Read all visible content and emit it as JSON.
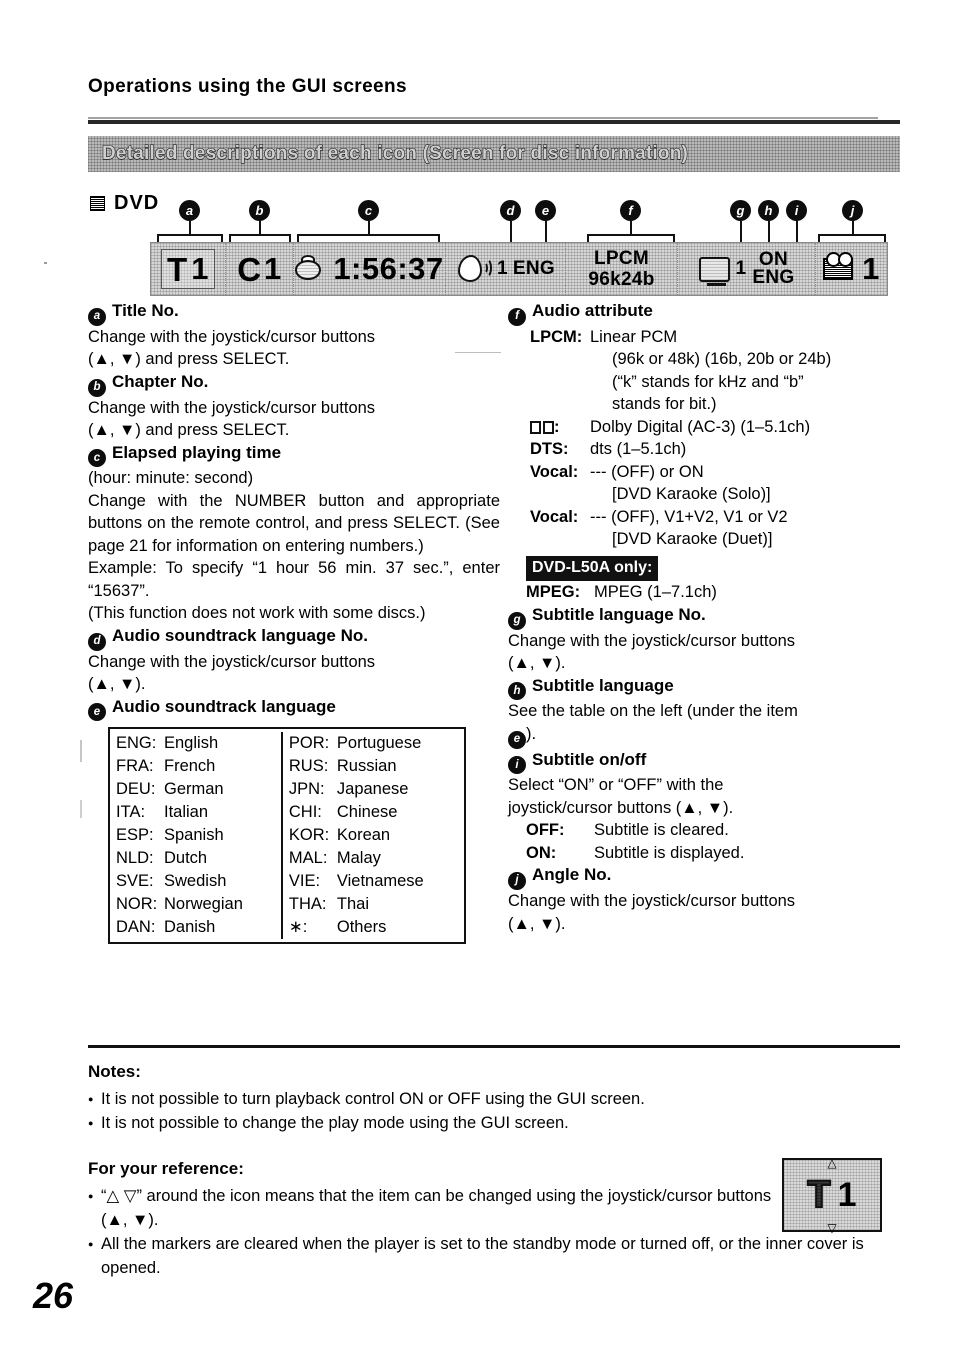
{
  "header": {
    "title": "Operations using the GUI screens",
    "banner": "Detailed descriptions of each icon (Screen for disc information)"
  },
  "disc_label": "DVD",
  "gui_bar": {
    "markers": [
      "a",
      "b",
      "c",
      "d",
      "e",
      "f",
      "g",
      "h",
      "i",
      "j"
    ],
    "title_no": {
      "icon": "T",
      "value": "1"
    },
    "chapter_no": {
      "icon": "C",
      "value": "1"
    },
    "elapsed_time": "1:56:37",
    "audio_track_no": "1",
    "audio_language": "ENG",
    "audio_attribute_line1": "LPCM",
    "audio_attribute_line2": "96k24b",
    "subtitle_no": "1",
    "subtitle_language": "ENG",
    "subtitle_onoff": "ON",
    "angle_no": "1"
  },
  "left_column": {
    "items": [
      {
        "marker": "a",
        "heading": "Title No.",
        "lines": [
          "Change with the joystick/cursor buttons",
          "(▲, ▼) and press SELECT."
        ]
      },
      {
        "marker": "b",
        "heading": "Chapter No.",
        "lines": [
          "Change with the joystick/cursor buttons",
          "(▲, ▼) and press SELECT."
        ]
      },
      {
        "marker": "c",
        "heading": "Elapsed playing time",
        "lines": [
          "(hour: minute: second)",
          "Change with the NUMBER button and appropriate buttons on the remote control, and press SELECT. (See page 21 for information on entering numbers.)",
          "Example:  To specify “1 hour 56 min. 37 sec.”, enter “15637”.",
          "(This function does not work with some discs.)"
        ]
      },
      {
        "marker": "d",
        "heading": "Audio soundtrack language No.",
        "lines": [
          "Change with the joystick/cursor buttons",
          "(▲, ▼)."
        ]
      },
      {
        "marker": "e",
        "heading": "Audio soundtrack language",
        "lines": []
      }
    ],
    "language_table": {
      "left": [
        {
          "code": "ENG:",
          "name": "English"
        },
        {
          "code": "FRA:",
          "name": "French"
        },
        {
          "code": "DEU:",
          "name": "German"
        },
        {
          "code": "ITA:",
          "name": "Italian"
        },
        {
          "code": "ESP:",
          "name": "Spanish"
        },
        {
          "code": "NLD:",
          "name": "Dutch"
        },
        {
          "code": "SVE:",
          "name": "Swedish"
        },
        {
          "code": "NOR:",
          "name": "Norwegian"
        },
        {
          "code": "DAN:",
          "name": "Danish"
        }
      ],
      "right": [
        {
          "code": "POR:",
          "name": "Portuguese"
        },
        {
          "code": "RUS:",
          "name": "Russian"
        },
        {
          "code": "JPN:",
          "name": "Japanese"
        },
        {
          "code": "CHI:",
          "name": "Chinese"
        },
        {
          "code": "KOR:",
          "name": "Korean"
        },
        {
          "code": "MAL:",
          "name": "Malay"
        },
        {
          "code": "VIE:",
          "name": "Vietnamese"
        },
        {
          "code": "THA:",
          "name": "Thai"
        },
        {
          "code": "∗:",
          "name": "Others"
        }
      ]
    }
  },
  "right_column": {
    "audio_attribute": {
      "marker": "f",
      "heading": "Audio attribute",
      "rows": [
        {
          "key": "LPCM:",
          "value": "Linear PCM"
        },
        {
          "key": "",
          "value": "(96k or 48k) (16b, 20b or 24b)"
        },
        {
          "key": "",
          "value": "(“k” stands for kHz and “b”"
        },
        {
          "key": "",
          "value": "stands for bit.)"
        },
        {
          "key": "DD:",
          "value": "Dolby Digital (AC-3) (1–5.1ch)"
        },
        {
          "key": "DTS:",
          "value": "dts (1–5.1ch)"
        },
        {
          "key": "Vocal:",
          "value": "--- (OFF) or ON"
        },
        {
          "key": "",
          "value": "[DVD Karaoke (Solo)]"
        },
        {
          "key": "Vocal:",
          "value": "--- (OFF), V1+V2, V1 or V2"
        },
        {
          "key": "",
          "value": "[DVD Karaoke (Duet)]"
        }
      ],
      "badge": "DVD-L50A only:",
      "mpeg_key": "MPEG:",
      "mpeg_value": "MPEG (1–7.1ch)"
    },
    "items": [
      {
        "marker": "g",
        "heading": "Subtitle language No.",
        "lines": [
          "Change with the joystick/cursor buttons",
          "(▲, ▼)."
        ]
      },
      {
        "marker": "h",
        "heading": "Subtitle language",
        "lines": [
          "See the table on the left (under the item",
          ")."
        ],
        "inline_marker": "e"
      },
      {
        "marker": "i",
        "heading": "Subtitle on/off",
        "lines": [
          "Select   “ON”   or   “OFF”   with   the",
          "joystick/cursor buttons (▲, ▼)."
        ],
        "defs": [
          {
            "key": "OFF:",
            "value": "Subtitle is cleared."
          },
          {
            "key": "ON:",
            "value": "Subtitle is displayed."
          }
        ]
      },
      {
        "marker": "j",
        "heading": "Angle No.",
        "lines": [
          "Change with the joystick/cursor buttons",
          "(▲, ▼)."
        ]
      }
    ]
  },
  "notes": {
    "heading": "Notes:",
    "items": [
      "It is not possible to turn playback control ON or OFF using the GUI screen.",
      "It is not possible to change the play mode using the GUI screen."
    ]
  },
  "reference": {
    "heading": "For your reference:",
    "items": [
      "“△ ▽” around the icon means that the item can be changed using the joystick/cursor buttons (▲, ▼).",
      "All the markers are cleared when the player is set to the standby mode or turned off, or the inner cover is opened."
    ],
    "icon": {
      "letter": "T",
      "value": "1",
      "up": "△",
      "down": "▽"
    }
  },
  "page_number": "26"
}
